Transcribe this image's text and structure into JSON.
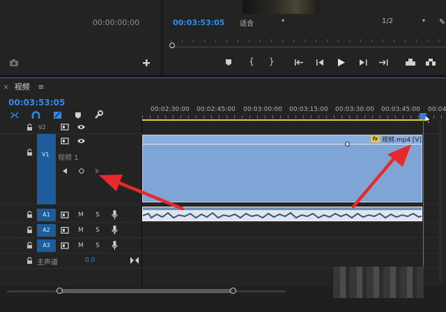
{
  "source_monitor": {
    "timecode": "00:00:00:00"
  },
  "program_monitor": {
    "timecode": "00:03:53:05",
    "fit_select": "适合",
    "resolution_select": "1/2"
  },
  "timeline": {
    "close_symbol": "×",
    "tab_label": "视频",
    "menu_symbol": "≡",
    "timecode": "00:03:53:05",
    "ruler_labels": [
      "00:02:30:00",
      "00:02:45:00",
      "00:03:00:00",
      "00:03:15:00",
      "00:03:30:00",
      "00:03:45:00",
      "00:04"
    ],
    "video_tracks": [
      {
        "label": "V2"
      },
      {
        "label": "V1",
        "name": "视频 1"
      }
    ],
    "audio_tracks": [
      {
        "label": "A1",
        "m": "M",
        "s": "S"
      },
      {
        "label": "A2",
        "m": "M",
        "s": "S"
      },
      {
        "label": "A3",
        "m": "M",
        "s": "S"
      }
    ],
    "master": {
      "label": "主声道",
      "value": "0.0"
    },
    "clip": {
      "fx_badge": "fx",
      "name": "视频.mp4 [V]"
    }
  },
  "colors": {
    "accent_blue": "#2d8ceb",
    "clip_video": "#7fa4d6",
    "clip_audio": "#dfe5ef",
    "playhead": "#3a7bd5",
    "arrow_red": "#e8282a",
    "work_area": "#e0d23a"
  }
}
